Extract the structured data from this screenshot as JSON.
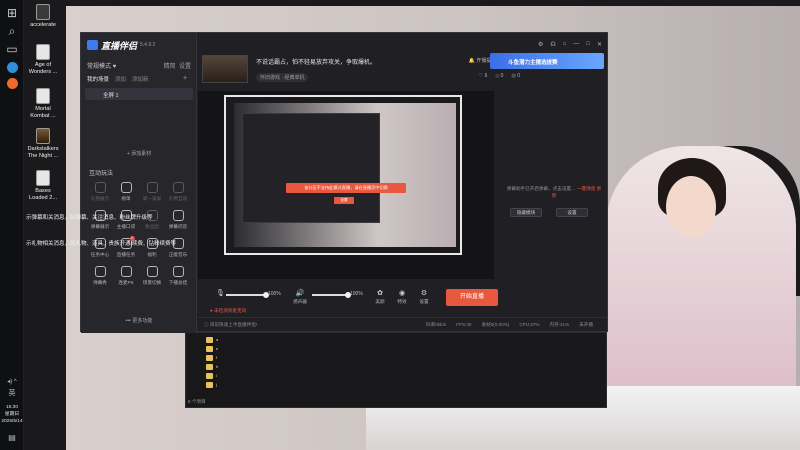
{
  "desktop": {
    "icons": [
      {
        "label": "accelerate"
      },
      {
        "label": "Age of Wonders ..."
      },
      {
        "label": "Mortal Kombat ..."
      },
      {
        "label": "Darkstalkers The Night ..."
      },
      {
        "label": "Bases Loaded 2..."
      }
    ],
    "tips": [
      "示弹幕和关消息，如弹幕、关注消息、粉丝牌升级等",
      "示礼物相关消息，如礼物、道具、贵族开通/续费、钻粉续费等"
    ]
  },
  "taskbar": {
    "ime": "英",
    "time": "15:30",
    "weekday": "星期日",
    "date": "2025/5/14"
  },
  "app": {
    "brand": "直播伴侣",
    "version": "5.4.9.2",
    "scene_title": "常规模式 ♥",
    "scene_actions": [
      "精简",
      "设置"
    ],
    "scene_tabs": [
      "我的场景",
      "添加",
      "添加新"
    ],
    "scene_item": "全屏 1",
    "add_source": "+ 添加素材",
    "interaction_title": "互动玩法",
    "tools": [
      {
        "label": "礼物展示",
        "dim": true
      },
      {
        "label": "榜单",
        "dim": false
      },
      {
        "label": "第一滚屏",
        "dim": true
      },
      {
        "label": "礼物互动",
        "dim": true
      },
      {
        "label": "弹幕展示",
        "dim": false
      },
      {
        "label": "主播口袋",
        "dim": false
      },
      {
        "label": "粉丝团",
        "dim": true
      },
      {
        "label": "弹幕问答",
        "dim": false
      },
      {
        "label": "任务中心",
        "dim": false
      },
      {
        "label": "直播任务",
        "dim": false,
        "badge": "2"
      },
      {
        "label": "福利",
        "dim": false
      },
      {
        "label": "正能音乐",
        "dim": false
      },
      {
        "label": "弹幕秀",
        "dim": false
      },
      {
        "label": "连麦PK",
        "dim": false
      },
      {
        "label": "场景切换",
        "dim": false
      },
      {
        "label": "下播总结",
        "dim": false
      }
    ],
    "more_label": "••• 更多功能",
    "stream_title": "不说话霸占，怕不轻易放弃攻关，争取爆机。",
    "stream_category": "怀旧游戏 · 经典单机",
    "top_icons": [
      "⚙",
      "☊",
      "⌂",
      "—",
      "□",
      "✕"
    ],
    "stats_top": [
      "开播提醒",
      "分享"
    ],
    "stats_bottom": [
      "6",
      "0",
      "0"
    ],
    "banner": "斗鱼潜力主播选拔赛",
    "preview_warning": "该分区不支持此模式直播，请在直播页中切换",
    "preview_warning_btn": "设置",
    "hint_text": "弹幕助手已开启弹幕，点击设置…",
    "hint_link": "一键弹窗",
    "hint_link2": "更新",
    "hint_buttons": [
      "隐藏模块",
      "设置"
    ],
    "controls": {
      "mic_pct": "100%",
      "spk_pct": "100%",
      "mic_fill": 1.0,
      "spk_fill": 1.0,
      "labels": [
        "扬声器",
        "美颜",
        "特效",
        "设置"
      ]
    },
    "warn_line": "● 未检测到麦克风",
    "start_button": "开始直播",
    "status_left": "ⓘ 目前快速上手直播伴侣!",
    "status_right": [
      "码率0kb/s",
      "FPS:30",
      "丢帧0(0.00%)",
      "CPU:37%",
      "内存:21%",
      "未开播"
    ]
  },
  "explorer": {
    "folders": [
      "a",
      "e",
      "f",
      "h",
      "i",
      "j"
    ],
    "footer": "8 个项目"
  }
}
